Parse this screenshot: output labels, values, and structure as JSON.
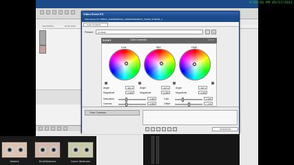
{
  "clock": "6:55:55 PM 05/27/2011",
  "dialog": {
    "title": "Video Event FX",
    "subtitle": "Video Event FX: 565579_1530596665109_1469933353000570_794018_3726093_n",
    "tab": "Color Corrector",
    "preset_label": "Preset:",
    "preset_value": "(Untitled)"
  },
  "color_corrector": {
    "brand": "SONY",
    "name": "Color Corrector",
    "about": "About",
    "wheels": [
      {
        "label": "Low",
        "angle": "347.1",
        "magnitude": "0.300"
      },
      {
        "label": "Mid",
        "angle": "347.3",
        "magnitude": "0.400"
      },
      {
        "label": "High",
        "angle": "347.1",
        "magnitude": "0.300"
      }
    ],
    "angle_label": "Angle",
    "magnitude_label": "Magnitude",
    "sliders": [
      {
        "label": "Saturation",
        "value": "1.000"
      },
      {
        "label": "Gamma",
        "value": "1.000"
      },
      {
        "label": "Gain",
        "value": "1.000"
      },
      {
        "label": "Offset",
        "value": "0.0"
      }
    ]
  },
  "fx_chain": {
    "item": "Color Corrector"
  },
  "fx_timecode": "00:00:00;00",
  "ruler_labels": [
    "00:00:00;00",
    "00:00:10;00"
  ],
  "thumbs": [
    {
      "label": "Wallets"
    },
    {
      "label": "Red/Midtones"
    },
    {
      "label": "Green Midtones"
    }
  ]
}
